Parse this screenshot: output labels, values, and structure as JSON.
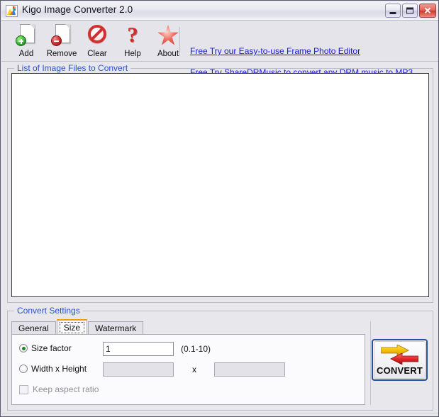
{
  "window": {
    "title": "Kigo Image Converter 2.0",
    "icon": "image-app-icon",
    "minimize_label": "Minimize",
    "maximize_label": "Maximize",
    "close_label": "Close",
    "close_glyph": "✕"
  },
  "toolbar": {
    "buttons": [
      {
        "label": "Add",
        "icon": "page-add-icon"
      },
      {
        "label": "Remove",
        "icon": "page-remove-icon"
      },
      {
        "label": "Clear",
        "icon": "no-entry-icon"
      },
      {
        "label": "Help",
        "icon": "question-mark-icon",
        "glyph": "?"
      },
      {
        "label": "About",
        "icon": "star-icon"
      }
    ],
    "links": [
      "Free Try our Easy-to-use Frame Photo Editor",
      "Free Try ShareDRMusic to convert any DRM music to MP3"
    ]
  },
  "file_list": {
    "group_title": "List of Image Files to Convert",
    "items": []
  },
  "settings": {
    "group_title": "Convert Settings",
    "tabs": [
      {
        "label": "General",
        "active": false
      },
      {
        "label": "Size",
        "active": true
      },
      {
        "label": "Watermark",
        "active": false
      }
    ],
    "size_tab": {
      "size_factor_label": "Size factor",
      "size_factor_value": "1",
      "size_factor_hint": "(0.1-10)",
      "width_height_label": "Width x Height",
      "width_value": "",
      "height_value": "",
      "dimension_separator": "x",
      "keep_aspect_label": "Keep aspect ratio"
    }
  },
  "convert": {
    "label": "CONVERT",
    "icon": "convert-arrows-icon"
  },
  "colors": {
    "link": "#1a1ad0",
    "group_title": "#2a4fd0",
    "active_tab_accent": "#f0a000",
    "convert_border": "#22539a",
    "arrow_yellow": "#f2b900",
    "arrow_red": "#d5202a"
  }
}
